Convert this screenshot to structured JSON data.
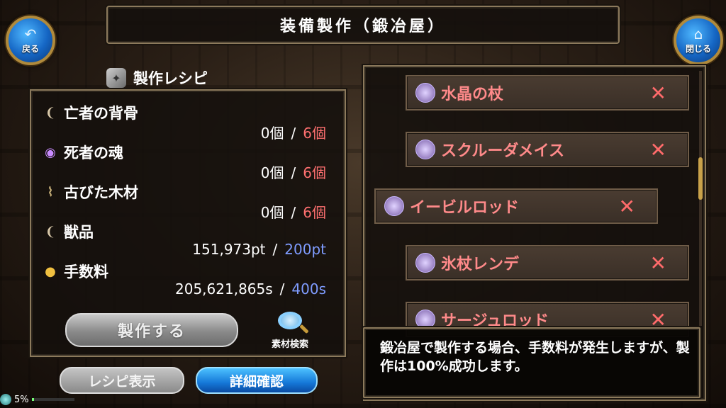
{
  "title": "装備製作（鍛冶屋）",
  "nav": {
    "back_label": "戻る",
    "close_label": "閉じる"
  },
  "recipe": {
    "header": "製作レシピ",
    "materials": [
      {
        "name": "亡者の背骨",
        "icon": "bone-icon",
        "have": "0個",
        "need": "6個"
      },
      {
        "name": "死者の魂",
        "icon": "soul-orb-icon",
        "have": "0個",
        "need": "6個"
      },
      {
        "name": "古びた木材",
        "icon": "wood-icon",
        "have": "0個",
        "need": "6個"
      }
    ],
    "pelt": {
      "name": "獣品",
      "icon": "fang-icon",
      "have": "151,973pt",
      "need": "200pt"
    },
    "fee": {
      "name": "手数料",
      "icon": "coins-icon",
      "have": "205,621,865s",
      "need": "400s"
    },
    "separator": "/"
  },
  "buttons": {
    "craft": "製作する",
    "material_search": "素材検索",
    "recipe_view": "レシピ表示",
    "detail": "詳細確認"
  },
  "item_list": [
    {
      "name": "水晶の杖",
      "selected": false
    },
    {
      "name": "スクルーダメイス",
      "selected": false
    },
    {
      "name": "イービルロッド",
      "selected": true
    },
    {
      "name": "氷杖レンデ",
      "selected": false
    },
    {
      "name": "サージュロッド",
      "selected": false
    }
  ],
  "info_text": "鍛冶屋で製作する場合、手数料が発生しますが、製作は100%成功します。",
  "status": {
    "progress_text": "5%",
    "progress_fraction": 0.05
  },
  "colors": {
    "insufficient": "#ff7070",
    "sufficient_req": "#7f9cff",
    "item_name": "#ff8a8a"
  }
}
